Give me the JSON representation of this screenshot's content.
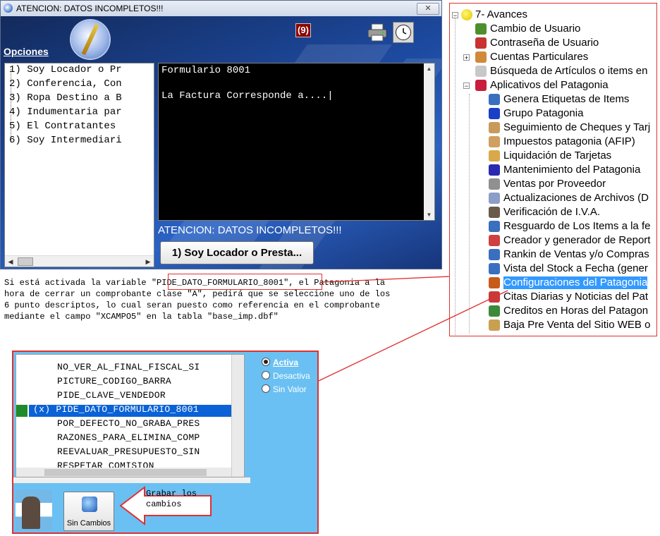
{
  "window": {
    "title": "ATENCION: DATOS INCOMPLETOS!!!",
    "close_glyph": "✕",
    "opciones_label": "Opciones",
    "badge": "(9)"
  },
  "options": [
    "1) Soy Locador o Pr",
    "2) Conferencia, Con",
    "3) Ropa Destino a B",
    "4) Indumentaria par",
    "5) El Contratantes",
    "6) Soy Intermediari"
  ],
  "terminal": {
    "line1": "Formulario 8001",
    "line2": "La Factura Corresponde a....",
    "cursor": "|"
  },
  "warning": "ATENCION: DATOS INCOMPLETOS!!!",
  "action_button": "1) Soy Locador o Presta...",
  "description": "Si está activada la variable \"PIDE_DATO_FORMULARIO_8001\", el Patagonia a la\nhora de cerrar un comprobante clase \"A\", pedirá que se seleccione uno de los\n6 punto descriptos, lo cual seran puesto como referencia en el comprobante\nmediante el campo \"XCAMPO5\" en la tabla \"base_imp.dbf\"",
  "tree": {
    "root": "7- Avances",
    "items": [
      {
        "label": "Cambio de Usuario",
        "icon": "users-icon",
        "color": "#4d8f2c"
      },
      {
        "label": "Contraseña de Usuario",
        "icon": "traffic-light-icon",
        "color": "#c83232"
      },
      {
        "label": "Cuentas Particulares",
        "icon": "accounts-icon",
        "color": "#d08a3a"
      },
      {
        "label": "Búsqueda de Artículos o items  en",
        "icon": "search-doc-icon",
        "color": "#c8c8c8"
      },
      {
        "label": "Aplicativos del Patagonia",
        "icon": "apps-icon",
        "color": "#c81e3c"
      }
    ],
    "children": [
      {
        "label": "Genera Etiquetas de Items",
        "icon": "label-icon",
        "color": "#3a6fc0"
      },
      {
        "label": "Grupo Patagonia",
        "icon": "group-icon",
        "color": "#1a3fc8"
      },
      {
        "label": "Seguimiento de Cheques y Tarj",
        "icon": "cheque-icon",
        "color": "#c89a5a"
      },
      {
        "label": "Impuestos patagonia (AFIP)",
        "icon": "tax-icon",
        "color": "#d0a060"
      },
      {
        "label": "Liquidación de Tarjetas",
        "icon": "card-icon",
        "color": "#d8a84a"
      },
      {
        "label": "Mantenimiento del Patagonia",
        "icon": "maintenance-icon",
        "color": "#2a2ab0"
      },
      {
        "label": "Ventas por Proveedor",
        "icon": "supplier-icon",
        "color": "#909090"
      },
      {
        "label": "Actualizaciones de Archivos (D",
        "icon": "update-icon",
        "color": "#8a9ec8"
      },
      {
        "label": "Verificación de I.V.A.",
        "icon": "person-icon",
        "color": "#6a5a4a"
      },
      {
        "label": "Resguardo de Los Items a la fe",
        "icon": "backup-icon",
        "color": "#3a6fc0"
      },
      {
        "label": "Creador y generador de Report",
        "icon": "report-icon",
        "color": "#d04040"
      },
      {
        "label": "Rankin de Ventas y/o Compras",
        "icon": "ranking-icon",
        "color": "#3a6fc0"
      },
      {
        "label": "Vista del Stock a Fecha (gener",
        "icon": "stock-icon",
        "color": "#3a6fc0"
      },
      {
        "label": "Configuraciones del Patagonia",
        "icon": "settings-icon",
        "color": "#c85a1a"
      },
      {
        "label": "Citas Diarias y Noticias del Pat",
        "icon": "news-icon",
        "color": "#c83a3a"
      },
      {
        "label": "Creditos en Horas del Patagon",
        "icon": "credits-icon",
        "color": "#3a8a3a"
      },
      {
        "label": "Baja Pre Venta del Sitio WEB o",
        "icon": "web-icon",
        "color": "#c8a050"
      }
    ]
  },
  "params": [
    "NO_VER_AL_FINAL_FISCAL_SI",
    "PICTURE_CODIGO_BARRA",
    "PIDE_CLAVE_VENDEDOR",
    "(x) PIDE_DATO_FORMULARIO_8001",
    "POR_DEFECTO_NO_GRABA_PRES",
    "RAZONES_PARA_ELIMINA_COMP",
    "REEVALUAR_PRESUPUESTO_SIN",
    "RESPETAR_COMISION"
  ],
  "radios": {
    "activa": "Activa",
    "desactiva": "Desactiva",
    "sin_valor": "Sin Valor"
  },
  "sin_cambios": "Sin Cambios",
  "callout": {
    "line1": "Grabar los",
    "line2": "cambios"
  },
  "colors": {
    "highlight_red": "#e03030",
    "selection_blue": "#3399ff",
    "panel_blue": "#6ac0f2"
  }
}
